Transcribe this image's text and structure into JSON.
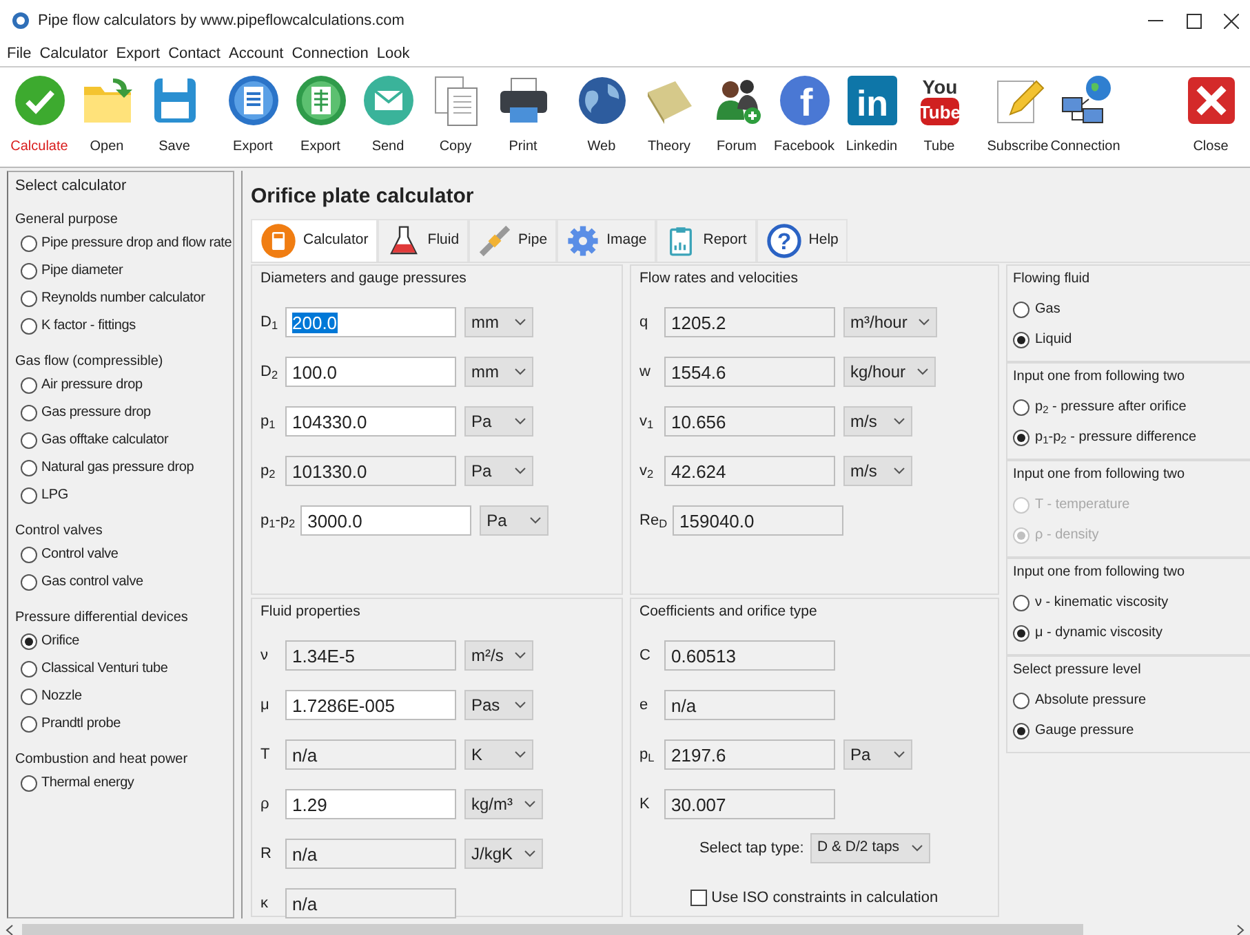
{
  "window": {
    "title": "Pipe flow calculators by www.pipeflowcalculations.com"
  },
  "menu": [
    "File",
    "Calculator",
    "Export",
    "Contact",
    "Account",
    "Connection",
    "Look"
  ],
  "toolbar": [
    {
      "items": [
        {
          "label": "Calculate",
          "kind": "check",
          "selected": true
        },
        {
          "label": "Open",
          "kind": "folder",
          "selected": false
        },
        {
          "label": "Save",
          "kind": "floppy",
          "selected": false
        }
      ]
    },
    {
      "items": [
        {
          "label": "Export",
          "kind": "word",
          "selected": false
        },
        {
          "label": "Export",
          "kind": "excel",
          "selected": false
        },
        {
          "label": "Send",
          "kind": "mail",
          "selected": false
        },
        {
          "label": "Copy",
          "kind": "copy",
          "selected": false
        },
        {
          "label": "Print",
          "kind": "printer",
          "selected": false
        }
      ]
    },
    {
      "items": [
        {
          "label": "Web",
          "kind": "globe",
          "selected": false
        },
        {
          "label": "Theory",
          "kind": "book",
          "selected": false
        },
        {
          "label": "Forum",
          "kind": "people",
          "selected": false
        },
        {
          "label": "Facebook",
          "kind": "facebook",
          "glyph_lines": [
            "f"
          ],
          "selected": false
        },
        {
          "label": "Linkedin",
          "kind": "linkedin",
          "glyph_lines": [
            "in"
          ],
          "selected": false
        },
        {
          "label": "Tube",
          "kind": "tube",
          "glyph_lines": [
            "You",
            "Tube"
          ],
          "selected": false
        }
      ]
    },
    {
      "items": [
        {
          "label": "Subscribe",
          "kind": "pencil",
          "selected": false
        },
        {
          "label": "Connection",
          "kind": "network",
          "selected": false
        }
      ]
    },
    {
      "items": [
        {
          "label": "Close",
          "kind": "close",
          "selected": false
        }
      ]
    }
  ],
  "sidebar": {
    "title": "Select calculator",
    "groups": [
      {
        "heading": "General purpose",
        "items": [
          {
            "label": "Pipe pressure drop and flow rate",
            "selected": false
          },
          {
            "label": "Pipe diameter",
            "selected": false
          },
          {
            "label": "Reynolds number calculator",
            "selected": false
          },
          {
            "label": "K factor - fittings",
            "selected": false
          }
        ]
      },
      {
        "heading": "Gas flow (compressible)",
        "items": [
          {
            "label": "Air pressure drop",
            "selected": false
          },
          {
            "label": "Gas pressure drop",
            "selected": false
          },
          {
            "label": "Gas offtake calculator",
            "selected": false
          },
          {
            "label": "Natural gas pressure drop",
            "selected": false
          },
          {
            "label": "LPG",
            "selected": false
          }
        ]
      },
      {
        "heading": "Control valves",
        "items": [
          {
            "label": "Control valve",
            "selected": false
          },
          {
            "label": "Gas control valve",
            "selected": false
          }
        ]
      },
      {
        "heading": "Pressure differential devices",
        "items": [
          {
            "label": "Orifice",
            "selected": true
          },
          {
            "label": "Classical Venturi tube",
            "selected": false
          },
          {
            "label": "Nozzle",
            "selected": false
          },
          {
            "label": "Prandtl probe",
            "selected": false
          }
        ]
      },
      {
        "heading": "Combustion and heat power",
        "items": [
          {
            "label": "Thermal energy",
            "selected": false
          }
        ]
      }
    ]
  },
  "calculator": {
    "title": "Orifice plate calculator",
    "tabs": [
      {
        "label": "Calculator",
        "kind": "calculator",
        "selected": true
      },
      {
        "label": "Fluid",
        "kind": "flask",
        "selected": false
      },
      {
        "label": "Pipe",
        "kind": "pipe",
        "selected": false
      },
      {
        "label": "Image",
        "kind": "gear",
        "selected": false
      },
      {
        "label": "Report",
        "kind": "clipboard",
        "selected": false
      },
      {
        "label": "Help",
        "kind": "help",
        "glyph": "?",
        "selected": false
      }
    ],
    "panels": [
      {
        "title": "Diameters and gauge pressures",
        "rows": [
          {
            "symbol": "D$_{1}$",
            "value": "200.0",
            "unit": "mm",
            "editable": true,
            "text_selected": true
          },
          {
            "symbol": "D$_{2}$",
            "value": "100.0",
            "unit": "mm",
            "editable": true,
            "text_selected": false
          },
          {
            "symbol": "p$_{1}$",
            "value": "104330.0",
            "unit": "Pa",
            "editable": true,
            "text_selected": false
          },
          {
            "symbol": "p$_{2}$",
            "value": "101330.0",
            "unit": "Pa",
            "editable": false,
            "text_selected": false
          },
          {
            "symbol": "p$_{1}$-p$_{2}$",
            "value": "3000.0",
            "unit": "Pa",
            "editable": true,
            "text_selected": false
          }
        ]
      },
      {
        "title": "Flow rates and velocities",
        "rows": [
          {
            "symbol": "q",
            "value": "1205.2",
            "unit": "m³/hour",
            "editable": false,
            "text_selected": false
          },
          {
            "symbol": "w",
            "value": "1554.6",
            "unit": "kg/hour",
            "editable": false,
            "text_selected": false
          },
          {
            "symbol": "v$_{1}$",
            "value": "10.656",
            "unit": "m/s",
            "editable": false,
            "text_selected": false
          },
          {
            "symbol": "v$_{2}$",
            "value": "42.624",
            "unit": "m/s",
            "editable": false,
            "text_selected": false
          },
          {
            "symbol": "Re$_{D}$",
            "value": "159040.0",
            "editable": false,
            "text_selected": false
          }
        ]
      },
      {
        "title": "Fluid properties",
        "rows": [
          {
            "symbol": "ν",
            "value": "1.34E-5",
            "unit": "m²/s",
            "editable": false,
            "text_selected": false
          },
          {
            "symbol": "μ",
            "value": "1.7286E-005",
            "unit": "Pas",
            "editable": true,
            "text_selected": false
          },
          {
            "symbol": "T",
            "value": "n/a",
            "unit": "K",
            "editable": false,
            "text_selected": false
          },
          {
            "symbol": "ρ",
            "value": "1.29",
            "unit": "kg/m³",
            "editable": true,
            "text_selected": false
          },
          {
            "symbol": "R",
            "value": "n/a",
            "unit": "J/kgK",
            "editable": false,
            "text_selected": false
          },
          {
            "symbol": "κ",
            "value": "n/a",
            "editable": false,
            "text_selected": false
          }
        ]
      },
      {
        "title": "Coefficients and orifice type",
        "rows": [
          {
            "symbol": "C",
            "value": "0.60513",
            "editable": false,
            "text_selected": false
          },
          {
            "symbol": "e",
            "value": "n/a",
            "editable": false,
            "text_selected": false
          },
          {
            "symbol": "p$_{L}$",
            "value": "2197.6",
            "unit": "Pa",
            "editable": false,
            "text_selected": false
          },
          {
            "symbol": "K",
            "value": "30.007",
            "editable": false,
            "text_selected": false
          }
        ],
        "tap_type": {
          "label": "Select tap type:",
          "value": "D & D/2 taps"
        },
        "iso_checkbox": {
          "label": "Use ISO constraints in calculation",
          "checked": false
        }
      }
    ],
    "options": [
      {
        "title": "Flowing fluid",
        "items": [
          {
            "label": "Gas",
            "selected": false,
            "disabled": false
          },
          {
            "label": "Liquid",
            "selected": true,
            "disabled": false
          }
        ]
      },
      {
        "title": "Input one from following two",
        "items": [
          {
            "label": "p$_{2}$ - pressure after orifice",
            "selected": false,
            "disabled": false
          },
          {
            "label": "p$_{1}$-p$_{2}$ - pressure difference",
            "selected": true,
            "disabled": false
          }
        ]
      },
      {
        "title": "Input one from following two",
        "items": [
          {
            "label": "T - temperature",
            "selected": false,
            "disabled": true
          },
          {
            "label": "ρ - density",
            "selected": true,
            "disabled": true
          }
        ]
      },
      {
        "title": "Input one from following two",
        "items": [
          {
            "label": "ν - kinematic viscosity",
            "selected": false,
            "disabled": false
          },
          {
            "label": "μ - dynamic viscosity",
            "selected": true,
            "disabled": false
          }
        ]
      },
      {
        "title": "Select pressure level",
        "items": [
          {
            "label": "Absolute pressure",
            "selected": false,
            "disabled": false
          },
          {
            "label": "Gauge pressure",
            "selected": true,
            "disabled": false
          }
        ]
      }
    ]
  }
}
